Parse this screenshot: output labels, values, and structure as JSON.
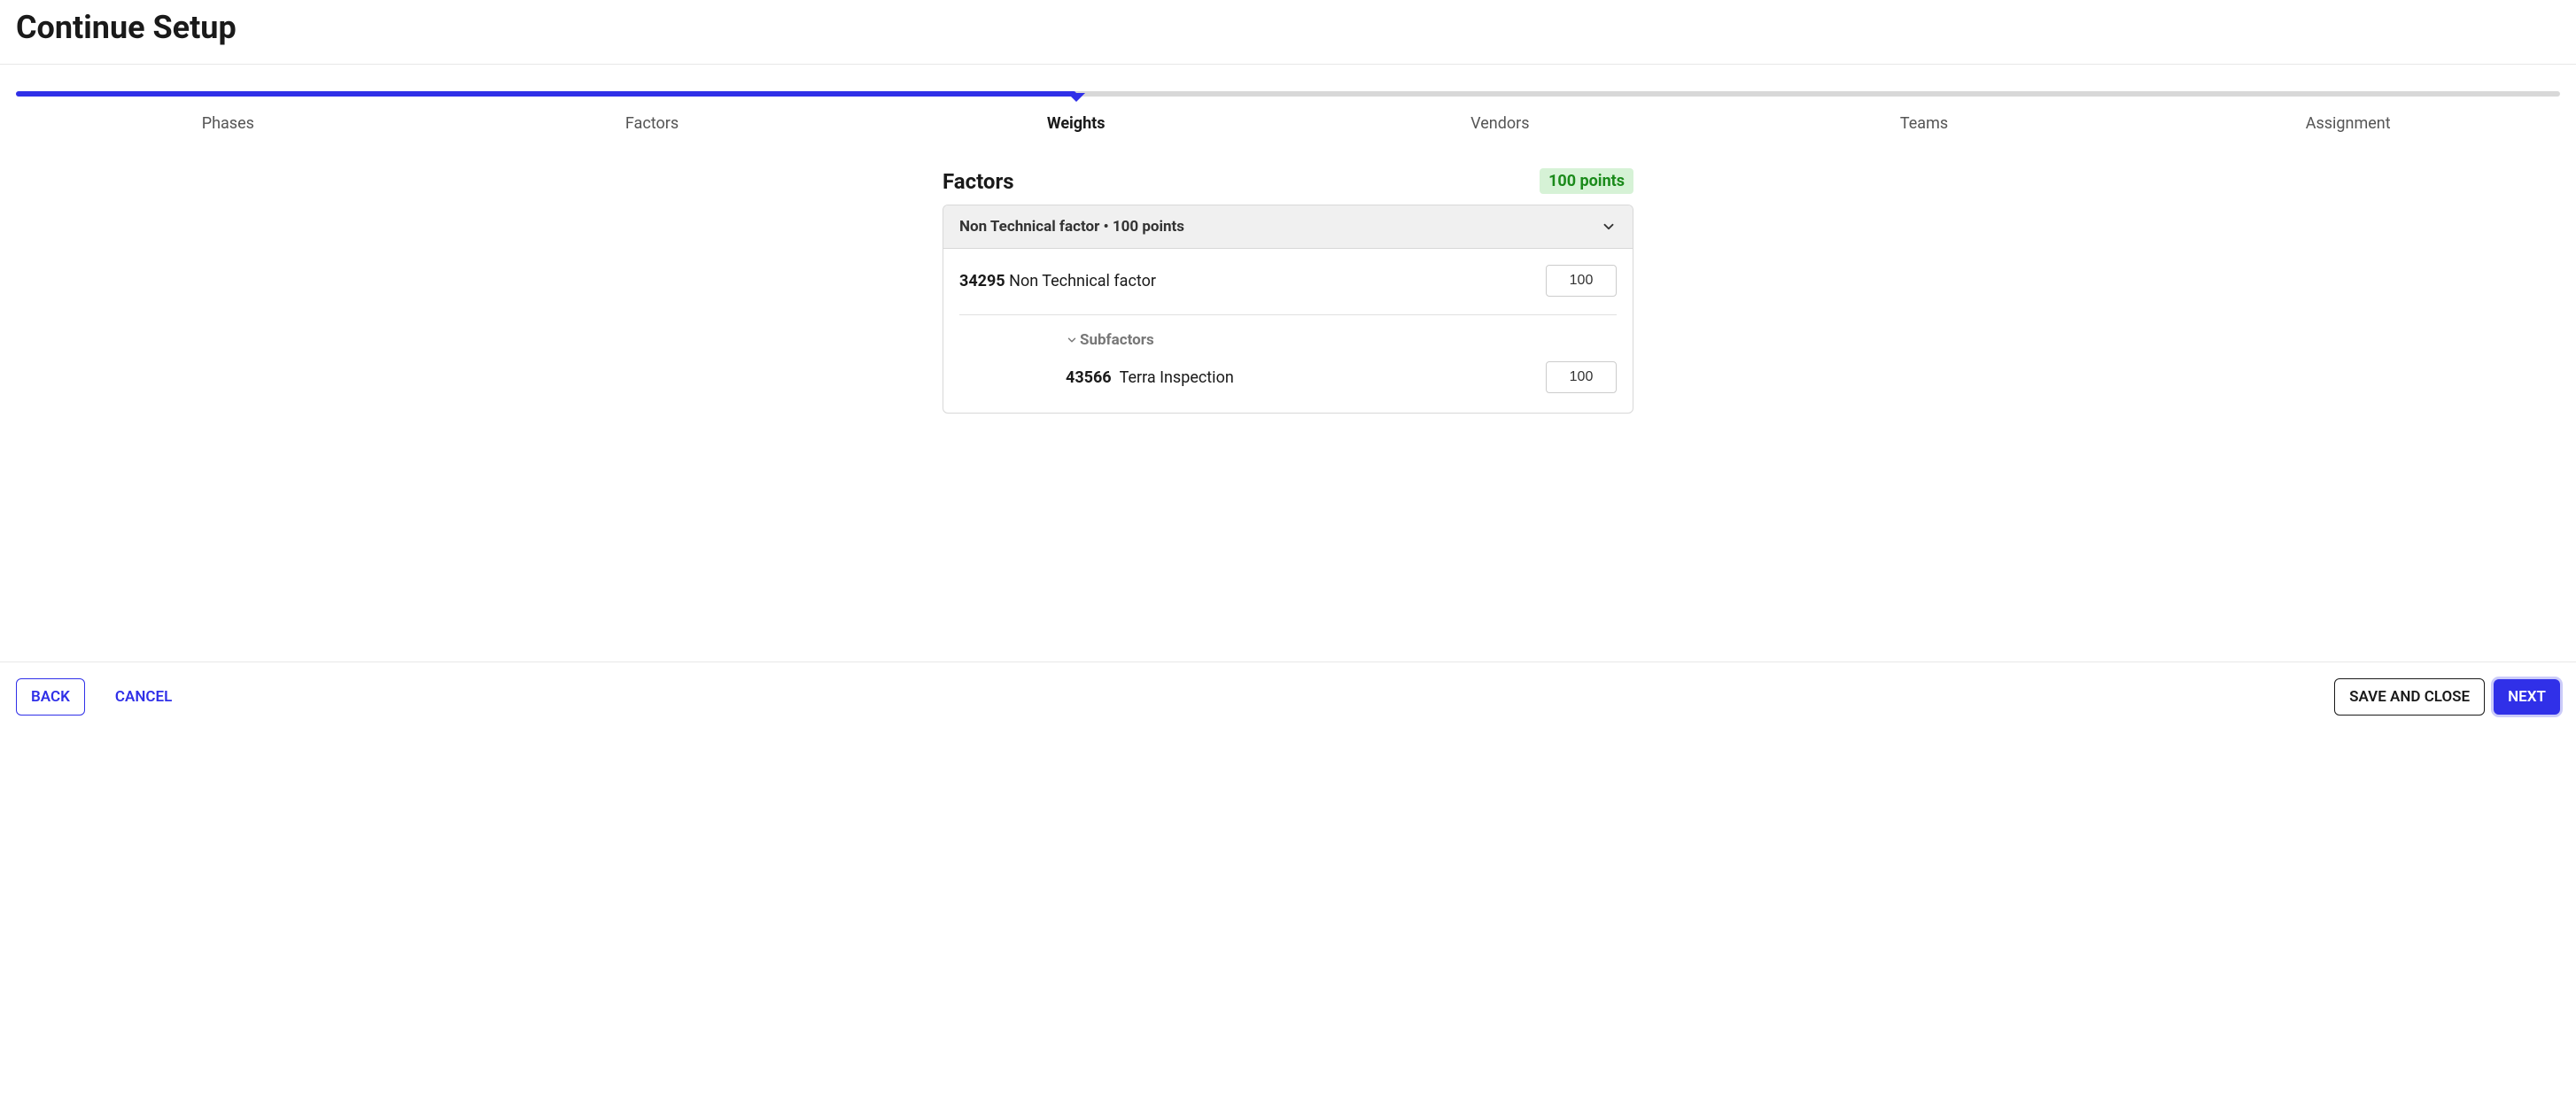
{
  "header": {
    "title": "Continue Setup"
  },
  "stepper": {
    "active_index": 2,
    "steps": [
      "Phases",
      "Factors",
      "Weights",
      "Vendors",
      "Teams",
      "Assignment"
    ]
  },
  "content": {
    "section_title": "Factors",
    "points_badge": "100 points",
    "group": {
      "header_text": "Non Technical factor • 100 points",
      "factor": {
        "id": "34295",
        "name": "Non Technical factor",
        "points_value": "100"
      },
      "subfactors_label": "Subfactors",
      "subfactors": [
        {
          "id": "43566",
          "name": "Terra Inspection",
          "points_value": "100"
        }
      ]
    }
  },
  "footer": {
    "back": "BACK",
    "cancel": "CANCEL",
    "save_close": "SAVE AND CLOSE",
    "next": "NEXT"
  }
}
